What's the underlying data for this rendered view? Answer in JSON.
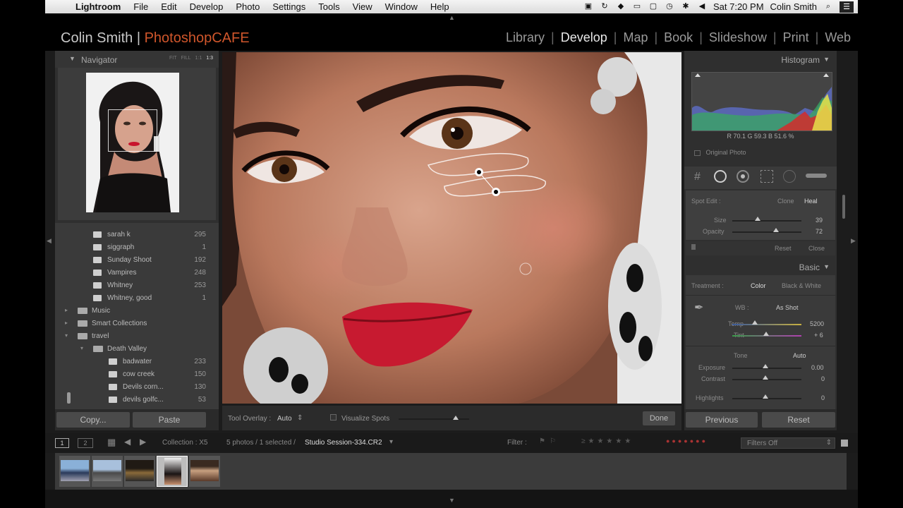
{
  "menubar": {
    "app": "Lightroom",
    "items": [
      "File",
      "Edit",
      "Develop",
      "Photo",
      "Settings",
      "Tools",
      "View",
      "Window",
      "Help"
    ],
    "clock": "Sat 7:20 PM",
    "user": "Colin Smith"
  },
  "identity": {
    "name": "Colin Smith",
    "separator": "|",
    "brand": "PhotoshopCAFE"
  },
  "modules": [
    "Library",
    "Develop",
    "Map",
    "Book",
    "Slideshow",
    "Print",
    "Web"
  ],
  "navigator": {
    "title": "Navigator",
    "zoom_options": [
      "FIT",
      "FILL",
      "1:1",
      "1:3"
    ]
  },
  "folders": [
    {
      "name": "sarah k",
      "count": "295",
      "level": 2,
      "kind": "folder"
    },
    {
      "name": "siggraph",
      "count": "1",
      "level": 2,
      "kind": "folder"
    },
    {
      "name": "Sunday Shoot",
      "count": "192",
      "level": 2,
      "kind": "folder"
    },
    {
      "name": "Vampires",
      "count": "248",
      "level": 2,
      "kind": "folder"
    },
    {
      "name": "Whitney",
      "count": "253",
      "level": 2,
      "kind": "folder"
    },
    {
      "name": "Whitney, good",
      "count": "1",
      "level": 2,
      "kind": "folder"
    },
    {
      "name": "Music",
      "count": "",
      "level": 1,
      "kind": "collection",
      "tri": "▸"
    },
    {
      "name": "Smart Collections",
      "count": "",
      "level": 1,
      "kind": "collection",
      "tri": "▸"
    },
    {
      "name": "travel",
      "count": "",
      "level": 1,
      "kind": "collection",
      "tri": "▾"
    },
    {
      "name": "Death Valley",
      "count": "",
      "level": 2,
      "kind": "collection",
      "tri": "▾"
    },
    {
      "name": "badwater",
      "count": "233",
      "level": 3,
      "kind": "folder"
    },
    {
      "name": "cow creek",
      "count": "150",
      "level": 3,
      "kind": "folder"
    },
    {
      "name": "Devils corn...",
      "count": "130",
      "level": 3,
      "kind": "folder"
    },
    {
      "name": "devils golfc...",
      "count": "53",
      "level": 3,
      "kind": "folder"
    }
  ],
  "left_buttons": {
    "copy": "Copy...",
    "paste": "Paste"
  },
  "toolbar": {
    "overlay_label": "Tool Overlay :",
    "overlay_value": "Auto",
    "visualize_label": "Visualize Spots",
    "done": "Done"
  },
  "histogram": {
    "title": "Histogram",
    "readout": "R 70.1   G 59.3   B 51.6 %",
    "original_photo": "Original Photo"
  },
  "spot_edit": {
    "label": "Spot Edit :",
    "clone": "Clone",
    "heal": "Heal",
    "size_label": "Size",
    "size_value": "39",
    "opacity_label": "Opacity",
    "opacity_value": "72",
    "reset": "Reset",
    "close": "Close"
  },
  "basic": {
    "title": "Basic",
    "treatment_label": "Treatment :",
    "color": "Color",
    "bw": "Black & White",
    "wb_label": "WB :",
    "wb_value": "As Shot",
    "temp_label": "Temp",
    "temp_value": "5200",
    "tint_label": "Tint",
    "tint_value": "+ 6",
    "tone_label": "Tone",
    "tone_auto": "Auto",
    "exposure_label": "Exposure",
    "exposure_value": "0.00",
    "contrast_label": "Contrast",
    "contrast_value": "0",
    "highlights_label": "Highlights",
    "highlights_value": "0"
  },
  "right_buttons": {
    "previous": "Previous",
    "reset": "Reset"
  },
  "filmbar": {
    "view1": "1",
    "view2": "2",
    "collection": "Collection : X5",
    "selection": "5 photos / 1 selected /",
    "filename": "Studio Session-334.CR2",
    "filter_label": "Filter :",
    "filters_off": "Filters Off"
  },
  "colors": {
    "brand": "#d0562b",
    "panel": "#2f2f2f",
    "background": "#1c1c1c"
  }
}
